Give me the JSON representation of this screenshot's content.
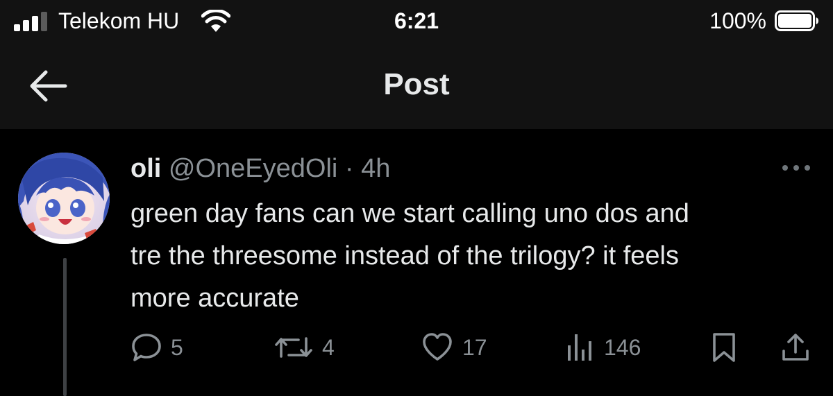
{
  "status_bar": {
    "carrier": "Telekom HU",
    "time": "6:21",
    "battery_percent": "100%",
    "signal_icon": "cellular-signal-icon",
    "wifi_icon": "wifi-icon",
    "battery_icon": "battery-full-icon"
  },
  "header": {
    "title": "Post",
    "back_icon": "back-arrow-icon"
  },
  "post": {
    "display_name": "oli",
    "handle": "@OneEyedOli",
    "separator": "·",
    "time_ago": "4h",
    "more_icon": "more-options-icon",
    "text_lines": [
      "green day fans can we start calling uno dos and",
      "tre the threesome instead of the trilogy? it feels",
      "more accurate"
    ],
    "actions": {
      "replies": "5",
      "reposts": "4",
      "likes": "17",
      "views": "146"
    },
    "action_icons": [
      "reply-icon",
      "repost-icon",
      "like-icon",
      "views-icon",
      "bookmark-icon",
      "share-icon"
    ]
  },
  "colors": {
    "background": "#000000",
    "bar_background": "#121212",
    "text_primary": "#e7e9ea",
    "text_secondary": "#8b9196",
    "thread_line": "#3e4144"
  }
}
